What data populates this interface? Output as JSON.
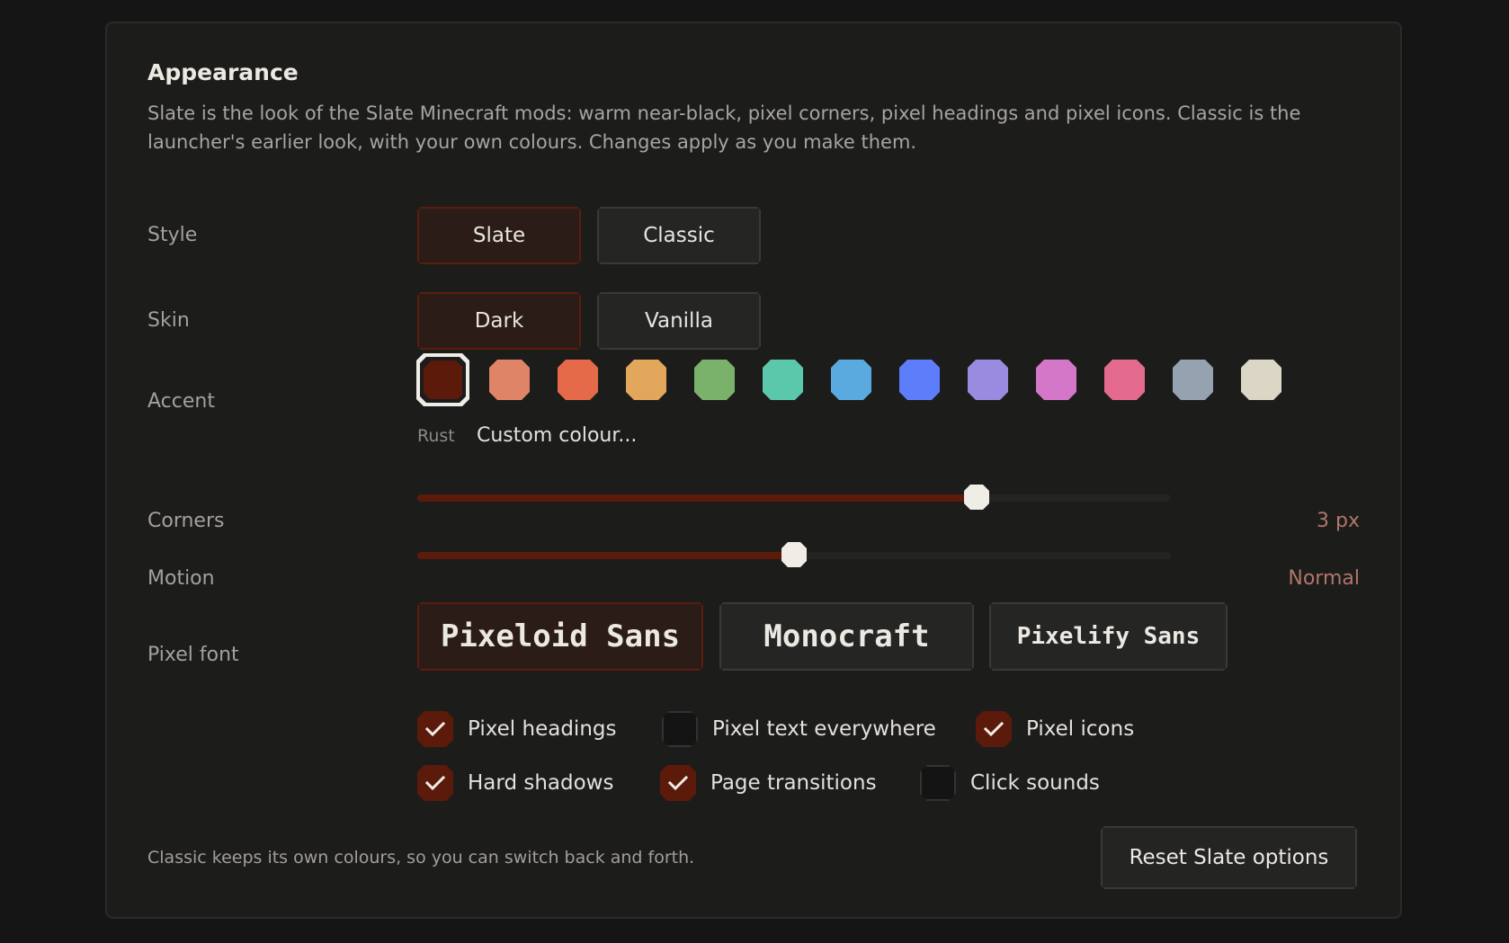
{
  "appearance": {
    "title": "Appearance",
    "description": "Slate is the look of the Slate Minecraft mods: warm near-black, pixel corners, pixel headings and pixel icons. Classic is the launcher's earlier look, with your own colours. Changes apply as you make them."
  },
  "style": {
    "label": "Style",
    "options": [
      "Slate",
      "Classic"
    ],
    "selected": "Slate"
  },
  "skin": {
    "label": "Skin",
    "options": [
      "Dark",
      "Vanilla"
    ],
    "selected": "Dark"
  },
  "accent": {
    "label": "Accent",
    "selected_name": "Rust",
    "custom_label": "Custom colour...",
    "swatches": [
      "#5c1a0a",
      "#df8467",
      "#e56a4a",
      "#e3a75c",
      "#7ab26c",
      "#5cc8ab",
      "#5aaae0",
      "#5e7dfb",
      "#9a8ae0",
      "#d477c9",
      "#e46a8e",
      "#95a2b0",
      "#dcd6c6"
    ]
  },
  "corners": {
    "label": "Corners",
    "value_text": "3 px",
    "fraction": 0.742
  },
  "motion": {
    "label": "Motion",
    "value_text": "Normal",
    "fraction": 0.5
  },
  "pixel_font": {
    "label": "Pixel font",
    "options": [
      "Pixeloid Sans",
      "Monocraft",
      "Pixelify Sans"
    ],
    "selected": "Pixeloid Sans"
  },
  "toggles": {
    "pixel_headings": {
      "label": "Pixel headings",
      "checked": true
    },
    "pixel_text_everywhere": {
      "label": "Pixel text everywhere",
      "checked": false
    },
    "pixel_icons": {
      "label": "Pixel icons",
      "checked": true
    },
    "hard_shadows": {
      "label": "Hard shadows",
      "checked": true
    },
    "page_transitions": {
      "label": "Page transitions",
      "checked": true
    },
    "click_sounds": {
      "label": "Click sounds",
      "checked": false
    }
  },
  "footer": {
    "note": "Classic keeps its own colours, so you can switch back and forth.",
    "reset_label": "Reset Slate options"
  },
  "colors": {
    "accent": "#5c1a0a",
    "value_text": "#b0766a",
    "panel_bg": "#1c1c1b"
  },
  "icons": {
    "check": "checkmark-icon"
  }
}
